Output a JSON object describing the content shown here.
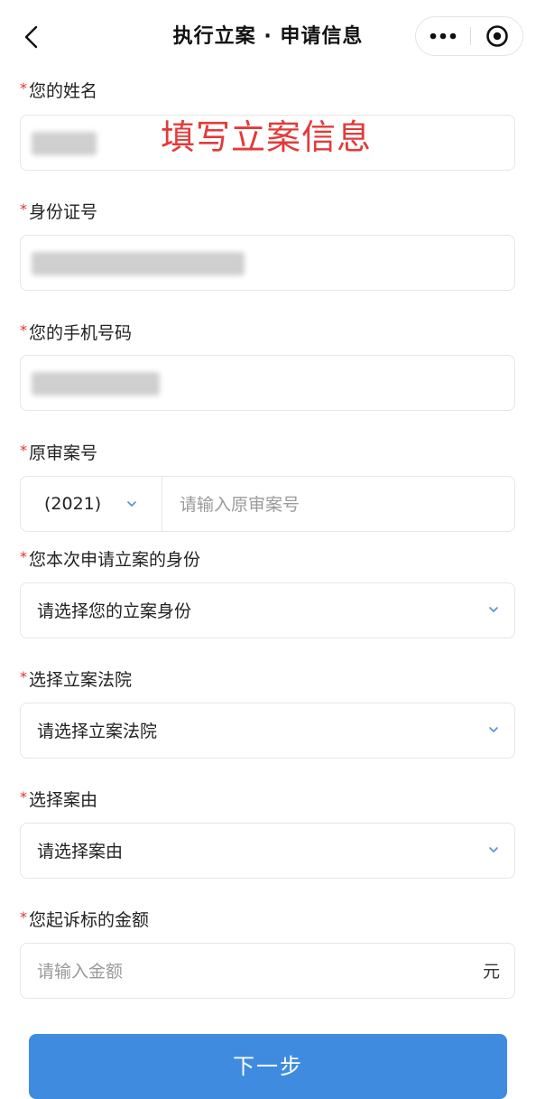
{
  "nav": {
    "title": "执行立案 · 申请信息"
  },
  "overlay_text": "填写立案信息",
  "form": {
    "name_label": "您的姓名",
    "id_label": "身份证号",
    "phone_label": "您的手机号码",
    "case_no_label": "原审案号",
    "year_value": "(2021)",
    "case_no_placeholder": "请输入原审案号",
    "identity_label": "您本次申请立案的身份",
    "identity_placeholder": "请选择您的立案身份",
    "court_label": "选择立案法院",
    "court_placeholder": "请选择立案法院",
    "cause_label": "选择案由",
    "cause_placeholder": "请选择案由",
    "amount_label": "您起诉标的金额",
    "amount_placeholder": "请输入金额",
    "amount_unit": "元",
    "required_mark": "*"
  },
  "footer": {
    "next_label": "下一步"
  },
  "colors": {
    "accent": "#3f8be0",
    "required": "#e03131",
    "overlay": "#e33a3a"
  },
  "icons": {
    "back": "chevron-left-icon",
    "more": "more-dots-icon",
    "close": "target-circle-icon",
    "dropdown": "chevron-down-icon"
  }
}
